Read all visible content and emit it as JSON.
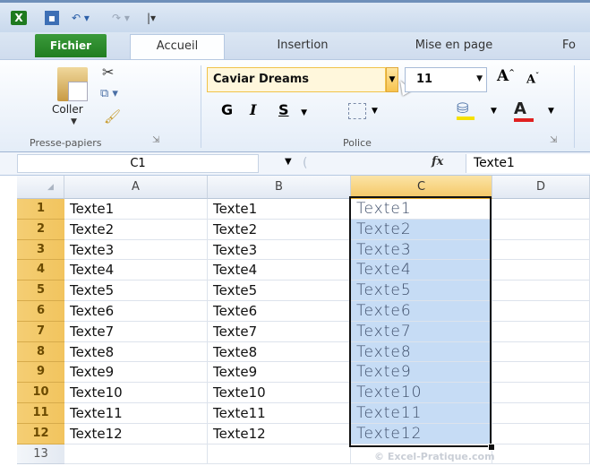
{
  "app": {
    "window_icon": "excel-icon"
  },
  "tabs": [
    {
      "label": "Fichier"
    },
    {
      "label": "Accueil"
    },
    {
      "label": "Insertion"
    },
    {
      "label": "Mise en page"
    },
    {
      "label": "Fo"
    }
  ],
  "ribbon": {
    "clipboard": {
      "paste_label": "Coller",
      "group_label": "Presse-papiers"
    },
    "font": {
      "font_name": "Caviar Dreams",
      "font_size": "11",
      "bold": "G",
      "italic": "I",
      "underline": "S",
      "font_color_glyph": "A",
      "group_label": "Police"
    }
  },
  "formula_bar": {
    "name_box": "C1",
    "fx": "fx",
    "content": "Texte1"
  },
  "columns": [
    "A",
    "B",
    "C",
    "D"
  ],
  "rows": [
    {
      "n": "1",
      "a": "Texte1",
      "b": "Texte1",
      "c": "Texte1"
    },
    {
      "n": "2",
      "a": "Texte2",
      "b": "Texte2",
      "c": "Texte2"
    },
    {
      "n": "3",
      "a": "Texte3",
      "b": "Texte3",
      "c": "Texte3"
    },
    {
      "n": "4",
      "a": "Texte4",
      "b": "Texte4",
      "c": "Texte4"
    },
    {
      "n": "5",
      "a": "Texte5",
      "b": "Texte5",
      "c": "Texte5"
    },
    {
      "n": "6",
      "a": "Texte6",
      "b": "Texte6",
      "c": "Texte6"
    },
    {
      "n": "7",
      "a": "Texte7",
      "b": "Texte7",
      "c": "Texte7"
    },
    {
      "n": "8",
      "a": "Texte8",
      "b": "Texte8",
      "c": "Texte8"
    },
    {
      "n": "9",
      "a": "Texte9",
      "b": "Texte9",
      "c": "Texte9"
    },
    {
      "n": "10",
      "a": "Texte10",
      "b": "Texte10",
      "c": "Texte10"
    },
    {
      "n": "11",
      "a": "Texte11",
      "b": "Texte11",
      "c": "Texte11"
    },
    {
      "n": "12",
      "a": "Texte12",
      "b": "Texte12",
      "c": "Texte12"
    },
    {
      "n": "13",
      "a": "",
      "b": "",
      "c": ""
    }
  ],
  "watermark": "© Excel-Pratique.com",
  "colors": {
    "file_tab": "#2b8a2b",
    "selection": "#c6dcf5",
    "header_selected": "#f5c867"
  }
}
